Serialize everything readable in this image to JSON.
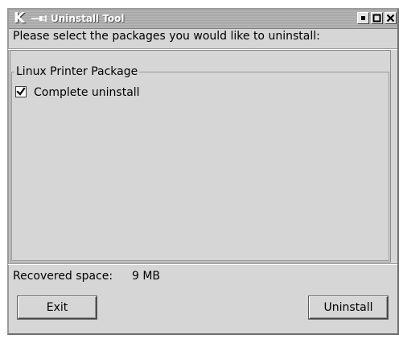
{
  "window": {
    "title": "Uninstall Tool",
    "app_icon": "kde-logo",
    "app_icon_glyph": "K",
    "titlebar_buttons": [
      "minimize-icon",
      "maximize-icon",
      "close-icon"
    ]
  },
  "prompt": "Please select the packages you would like to uninstall:",
  "package_group": {
    "title": "Linux Printer Package",
    "options": [
      {
        "label": "Complete uninstall",
        "checked": true
      }
    ]
  },
  "status": {
    "recovered_label": "Recovered space:",
    "recovered_value": "9 MB"
  },
  "buttons": {
    "exit": "Exit",
    "uninstall": "Uninstall"
  }
}
